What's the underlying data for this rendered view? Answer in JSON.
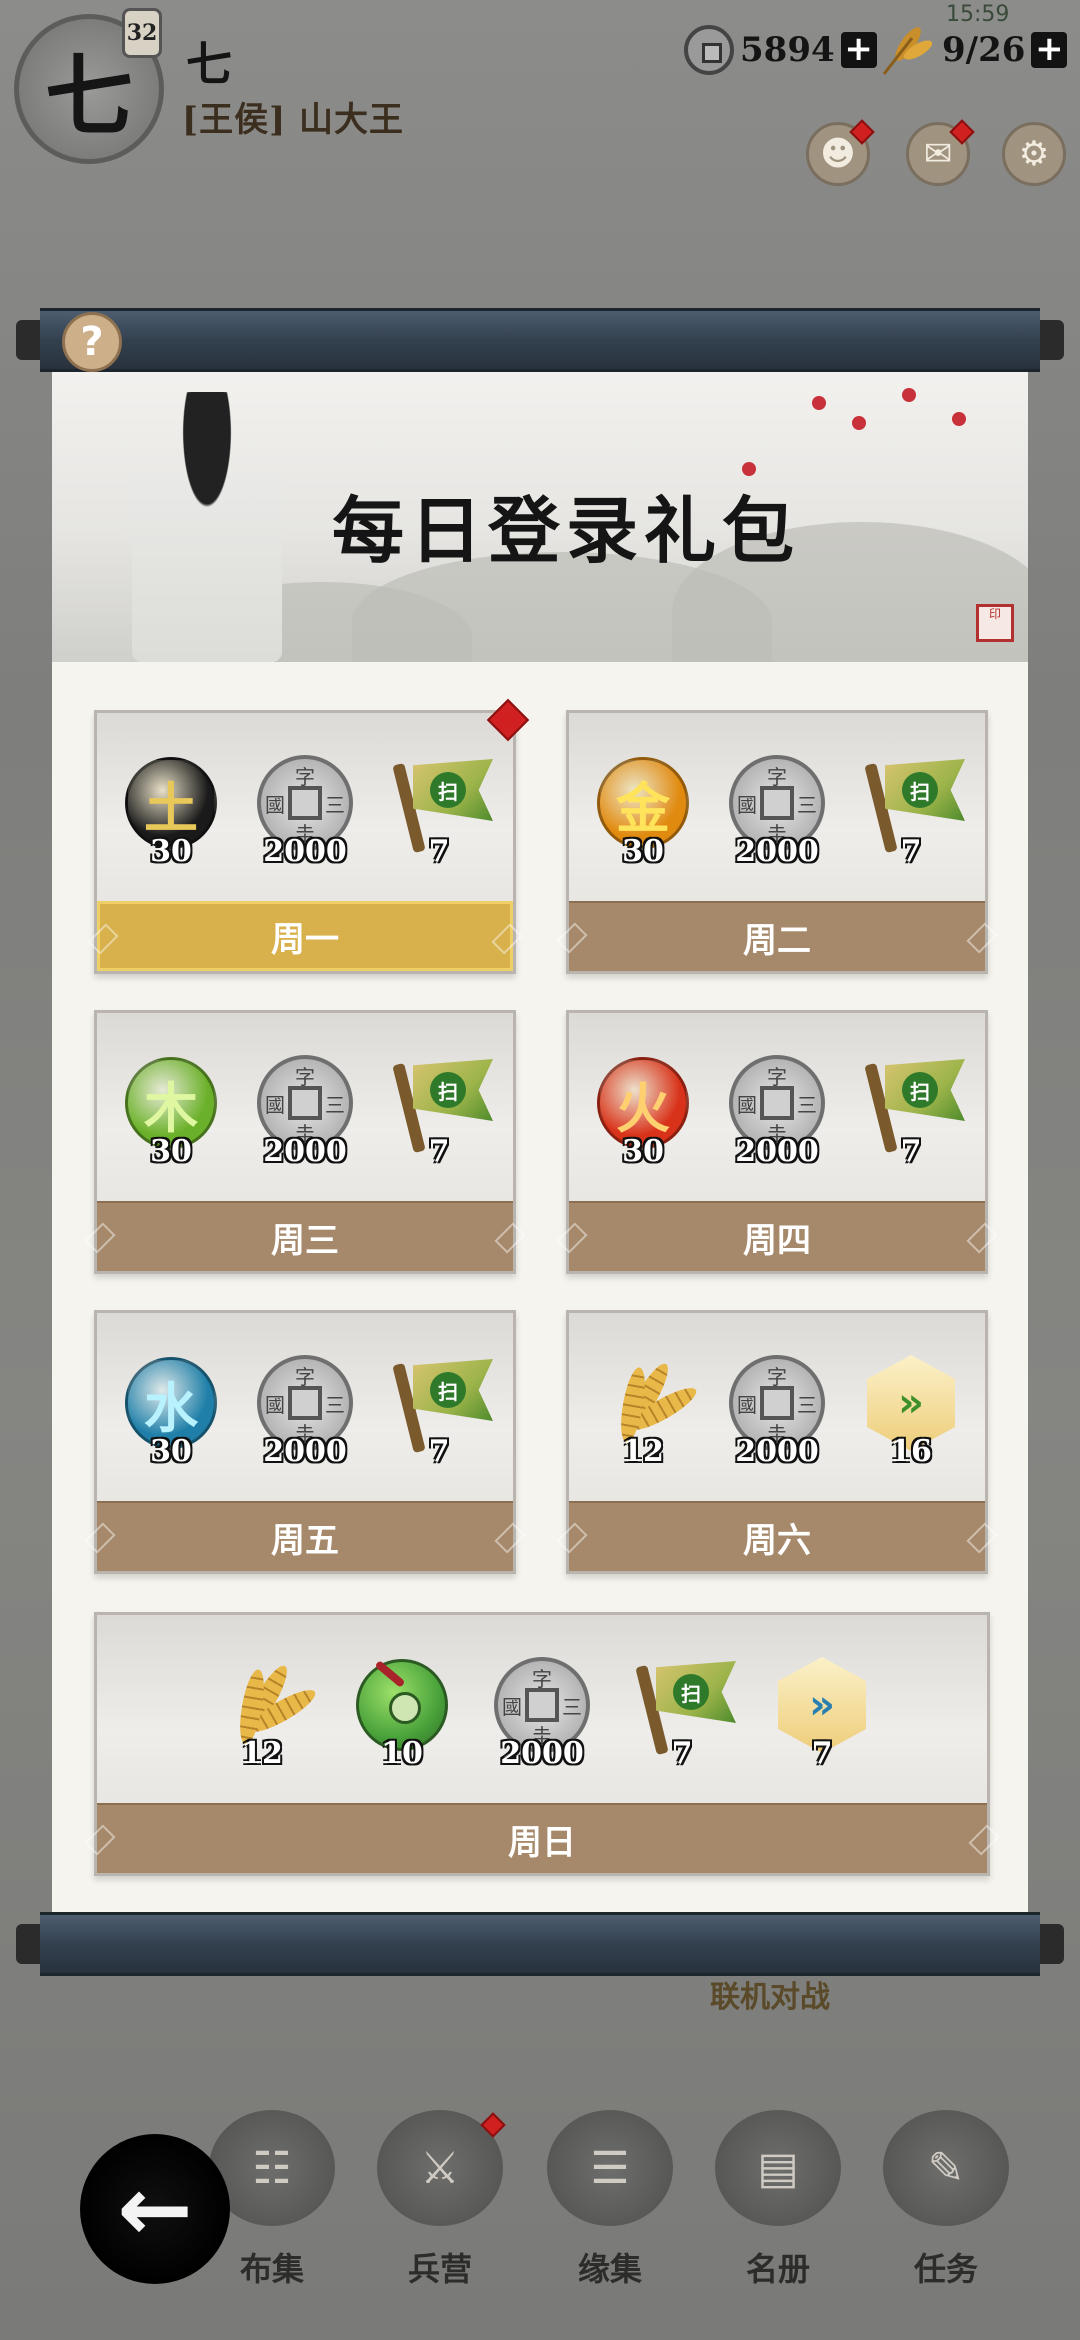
{
  "player": {
    "avatar_glyph": "七",
    "level": "32",
    "name": "七",
    "title": "[王侯] 山大王"
  },
  "status": {
    "time": "15:59",
    "coins": "5894",
    "stamina": "9/26",
    "plus": "+"
  },
  "top_buttons": {
    "friends_icon": "friends-icon",
    "mail_icon": "mail-icon",
    "settings_icon": "gear-icon"
  },
  "dialog": {
    "help": "?",
    "banner_title": "每日登录礼包"
  },
  "days": [
    {
      "label": "周一",
      "active": true,
      "items": [
        {
          "type": "orb",
          "glyph": "土",
          "color": "#1a1a1a",
          "fg": "#e9c85a",
          "count": "30"
        },
        {
          "type": "coin",
          "count": "2000"
        },
        {
          "type": "flag",
          "count": "7"
        }
      ]
    },
    {
      "label": "周二",
      "active": false,
      "items": [
        {
          "type": "orb",
          "glyph": "金",
          "color": "#e08a10",
          "fg": "#ffe35a",
          "count": "30"
        },
        {
          "type": "coin",
          "count": "2000"
        },
        {
          "type": "flag",
          "count": "7"
        }
      ]
    },
    {
      "label": "周三",
      "active": false,
      "items": [
        {
          "type": "orb",
          "glyph": "木",
          "color": "#6bb02a",
          "fg": "#dff7a0",
          "count": "30"
        },
        {
          "type": "coin",
          "count": "2000"
        },
        {
          "type": "flag",
          "count": "7"
        }
      ]
    },
    {
      "label": "周四",
      "active": false,
      "items": [
        {
          "type": "orb",
          "glyph": "火",
          "color": "#d8321a",
          "fg": "#ffd070",
          "count": "30"
        },
        {
          "type": "coin",
          "count": "2000"
        },
        {
          "type": "flag",
          "count": "7"
        }
      ]
    },
    {
      "label": "周五",
      "active": false,
      "items": [
        {
          "type": "orb",
          "glyph": "水",
          "color": "#1f7fa8",
          "fg": "#b9f2ff",
          "count": "30"
        },
        {
          "type": "coin",
          "count": "2000"
        },
        {
          "type": "flag",
          "count": "7"
        }
      ]
    },
    {
      "label": "周六",
      "active": false,
      "items": [
        {
          "type": "wheat",
          "count": "12"
        },
        {
          "type": "coin",
          "count": "2000"
        },
        {
          "type": "hex",
          "glyph": "»",
          "fg": "#3d8f2a",
          "count": "16"
        }
      ]
    },
    {
      "label": "周日",
      "active": false,
      "items": [
        {
          "type": "wheat",
          "count": "12"
        },
        {
          "type": "jade",
          "count": "10"
        },
        {
          "type": "coin",
          "count": "2000"
        },
        {
          "type": "flag",
          "count": "7"
        },
        {
          "type": "hex",
          "glyph": "»",
          "fg": "#2a7fb0",
          "count": "7"
        }
      ]
    }
  ],
  "coin_chars": {
    "top": "字",
    "left": "國",
    "right": "三",
    "bottom": "圭"
  },
  "flag_char": "扫",
  "background_text": "联机对战",
  "nav": [
    {
      "label": "布集",
      "icon": "scroll-icon"
    },
    {
      "label": "兵营",
      "icon": "barracks-icon"
    },
    {
      "label": "缘集",
      "icon": "book-icon"
    },
    {
      "label": "名册",
      "icon": "register-icon"
    },
    {
      "label": "任务",
      "icon": "task-scroll-icon"
    }
  ],
  "back_icon": "back-arrow-icon",
  "back_glyph": "←"
}
